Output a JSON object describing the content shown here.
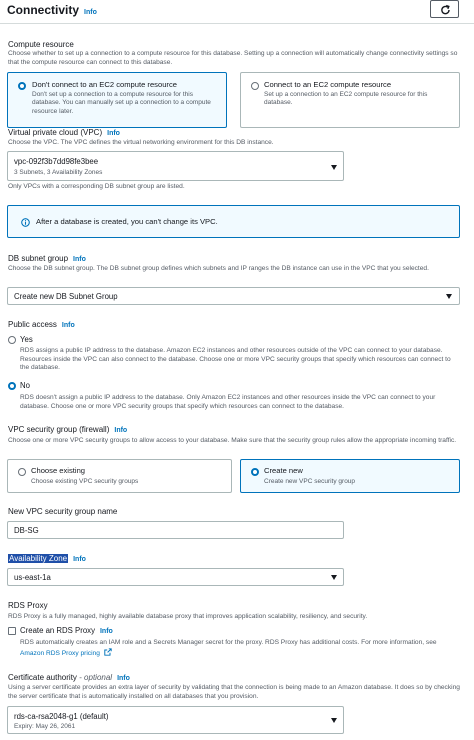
{
  "header": {
    "title": "Connectivity",
    "info": "Info"
  },
  "compute": {
    "label": "Compute resource",
    "desc": "Choose whether to set up a connection to a compute resource for this database. Setting up a connection will automatically change connectivity settings so that the compute resource can connect to this database.",
    "options": [
      {
        "title": "Don't connect to an EC2 compute resource",
        "desc": "Don't set up a connection to a compute resource for this database. You can manually set up a connection to a compute resource later."
      },
      {
        "title": "Connect to an EC2 compute resource",
        "desc": "Set up a connection to an EC2 compute resource for this database."
      }
    ]
  },
  "vpc": {
    "label": "Virtual private cloud (VPC)",
    "info": "Info",
    "desc": "Choose the VPC. The VPC defines the virtual networking environment for this DB instance.",
    "value": "vpc-092f3b7dd98fe3bee",
    "subvalue": "3 Subnets, 3 Availability Zones",
    "hint": "Only VPCs with a corresponding DB subnet group are listed."
  },
  "alert": {
    "text": "After a database is created, you can't change its VPC."
  },
  "subnet": {
    "label": "DB subnet group",
    "info": "Info",
    "desc": "Choose the DB subnet group. The DB subnet group defines which subnets and IP ranges the DB instance can use in the VPC that you selected.",
    "value": "Create new DB Subnet Group"
  },
  "public": {
    "label": "Public access",
    "info": "Info",
    "yes_label": "Yes",
    "yes_desc": "RDS assigns a public IP address to the database. Amazon EC2 instances and other resources outside of the VPC can connect to your database. Resources inside the VPC can also connect to the database. Choose one or more VPC security groups that specify which resources can connect to the database.",
    "no_label": "No",
    "no_desc": "RDS doesn't assign a public IP address to the database. Only Amazon EC2 instances and other resources inside the VPC can connect to your database. Choose one or more VPC security groups that specify which resources can connect to the database."
  },
  "sg": {
    "label": "VPC security group (firewall)",
    "info": "Info",
    "desc": "Choose one or more VPC security groups to allow access to your database. Make sure that the security group rules allow the appropriate incoming traffic.",
    "options": [
      {
        "title": "Choose existing",
        "desc": "Choose existing VPC security groups"
      },
      {
        "title": "Create new",
        "desc": "Create new VPC security group"
      }
    ]
  },
  "newsg": {
    "label": "New VPC security group name",
    "value": "DB-SG"
  },
  "az": {
    "label": "Availability Zone",
    "info": "Info",
    "value": "us-east-1a"
  },
  "proxy": {
    "label": "RDS Proxy",
    "desc": "RDS Proxy is a fully managed, highly available database proxy that improves application scalability, resiliency, and security.",
    "check_label": "Create an RDS Proxy",
    "info": "Info",
    "check_desc": "RDS automatically creates an IAM role and a Secrets Manager secret for the proxy. RDS Proxy has additional costs. For more information, see",
    "pricing_link": "Amazon RDS Proxy pricing"
  },
  "cert": {
    "label": "Certificate authority",
    "optional": "- optional",
    "info": "Info",
    "desc": "Using a server certificate provides an extra layer of security by validating that the connection is being made to an Amazon database. It does so by checking the server certificate that is automatically installed on all databases that you provision.",
    "value": "rds-ca-rsa2048-g1 (default)",
    "expiry": "Expiry: May 26, 2061"
  }
}
